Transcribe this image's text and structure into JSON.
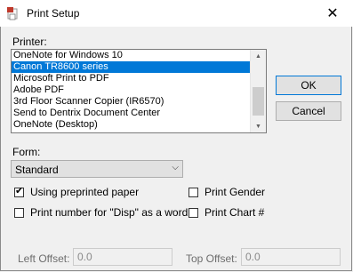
{
  "window": {
    "title": "Print Setup",
    "close_symbol": "✕"
  },
  "printer": {
    "label": "Printer:",
    "items": [
      "OneNote for Windows 10",
      "Canon TR8600 series",
      "Microsoft Print to PDF",
      "Adobe PDF",
      "3rd Floor Scanner Copier (IR6570)",
      "Send to Dentrix Document Center",
      "OneNote (Desktop)"
    ],
    "selected_index": 1
  },
  "buttons": {
    "ok": "OK",
    "cancel": "Cancel"
  },
  "form": {
    "label": "Form:",
    "value": "Standard"
  },
  "options": {
    "using_preprinted": {
      "label": "Using preprinted paper",
      "checked": true
    },
    "print_gender": {
      "label": "Print Gender",
      "checked": false
    },
    "print_number_word": {
      "label": "Print number for \"Disp\" as a word",
      "checked": false
    },
    "print_chart": {
      "label": "Print Chart #",
      "checked": false
    }
  },
  "offsets": {
    "left_label": "Left Offset:",
    "left_value": "0.0",
    "top_label": "Top Offset:",
    "top_value": "0.0"
  },
  "icons": {
    "app": "printer-app-icon"
  }
}
